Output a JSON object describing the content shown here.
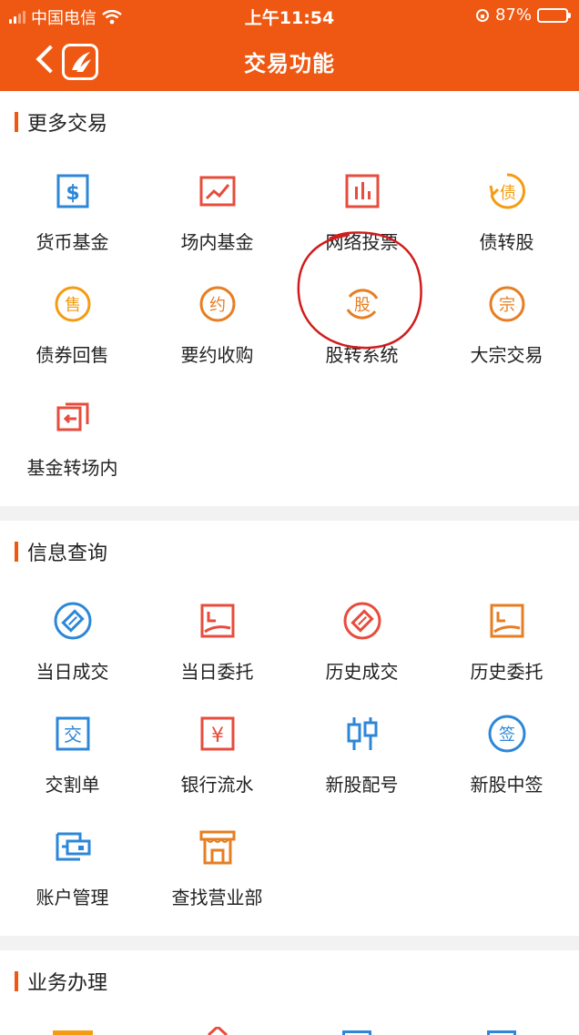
{
  "status_bar": {
    "carrier": "中国电信",
    "time": "上午11:54",
    "battery_pct": "87%"
  },
  "nav": {
    "title": "交易功能"
  },
  "sections": [
    {
      "title": "更多交易",
      "items": [
        {
          "label": "货币基金",
          "icon": "dollar-square-icon",
          "color": "#2d87d8"
        },
        {
          "label": "场内基金",
          "icon": "trend-chart-icon",
          "color": "#e74c3c"
        },
        {
          "label": "网络投票",
          "icon": "bar-chart-icon",
          "color": "#e74c3c"
        },
        {
          "label": "债转股",
          "icon": "bond-circle-icon",
          "color": "#f39c12"
        },
        {
          "label": "债券回售",
          "icon": "sell-circle-icon",
          "color": "#f39c12"
        },
        {
          "label": "要约收购",
          "icon": "offer-circle-icon",
          "color": "#e67e22"
        },
        {
          "label": "股转系统",
          "icon": "share-cycle-icon",
          "color": "#e67e22"
        },
        {
          "label": "大宗交易",
          "icon": "bulk-circle-icon",
          "color": "#e67e22"
        },
        {
          "label": "基金转场内",
          "icon": "transfer-icon",
          "color": "#e74c3c"
        }
      ]
    },
    {
      "title": "信息查询",
      "items": [
        {
          "label": "当日成交",
          "icon": "gavel-circle-icon",
          "color": "#2d87d8"
        },
        {
          "label": "当日委托",
          "icon": "entrust-doc-icon",
          "color": "#e74c3c"
        },
        {
          "label": "历史成交",
          "icon": "gavel-circle-icon",
          "color": "#e74c3c"
        },
        {
          "label": "历史委托",
          "icon": "entrust-doc-icon",
          "color": "#e67e22"
        },
        {
          "label": "交割单",
          "icon": "delivery-doc-icon",
          "color": "#2d87d8"
        },
        {
          "label": "银行流水",
          "icon": "yuan-doc-icon",
          "color": "#e74c3c"
        },
        {
          "label": "新股配号",
          "icon": "candlestick-icon",
          "color": "#2d87d8"
        },
        {
          "label": "新股中签",
          "icon": "sign-circle-icon",
          "color": "#2d87d8"
        },
        {
          "label": "账户管理",
          "icon": "account-card-icon",
          "color": "#2d87d8"
        },
        {
          "label": "查找营业部",
          "icon": "storefront-icon",
          "color": "#e67e22"
        }
      ]
    },
    {
      "title": "业务办理"
    }
  ]
}
